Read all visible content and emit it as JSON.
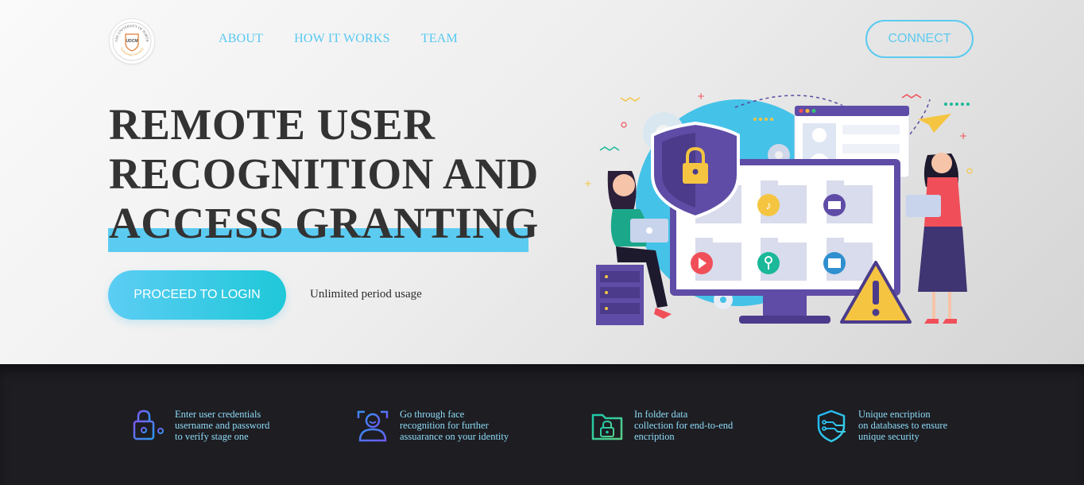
{
  "logo": {
    "name": "university-crest-icon",
    "ring_top": "THE UNIVERSITY OF NORTH",
    "ring_bottom": "Technology University",
    "shield_text": "UDCM"
  },
  "nav": {
    "about": "ABOUT",
    "how_it_works": "HOW IT WORKS",
    "team": "TEAM"
  },
  "connect_label": "CONNECT",
  "headline": {
    "line1": "REMOTE USER",
    "line2": "RECOGNITION AND",
    "line3": "ACCESS GRANTING"
  },
  "proceed_label": "PROCEED TO LOGIN",
  "usage_text": "Unlimited period usage",
  "features": [
    {
      "icon": "padlock-key-icon",
      "lines": [
        "Enter user credentials",
        "username and password",
        "to verify stage one"
      ]
    },
    {
      "icon": "face-recognition-icon",
      "lines": [
        "Go through face",
        "recognition for further",
        "assuarance on your identity"
      ]
    },
    {
      "icon": "locked-folder-icon",
      "lines": [
        "In folder data",
        "collection for end-to-end",
        "encription"
      ]
    },
    {
      "icon": "shield-circuit-icon",
      "lines": [
        "Unique encription",
        "on databases to ensure",
        "unique security"
      ]
    }
  ],
  "colors": {
    "accent": "#5ccbf2",
    "headline_text": "#333333",
    "footer_bg": "#1d1d22",
    "feature_text": "#8fdcf7"
  }
}
